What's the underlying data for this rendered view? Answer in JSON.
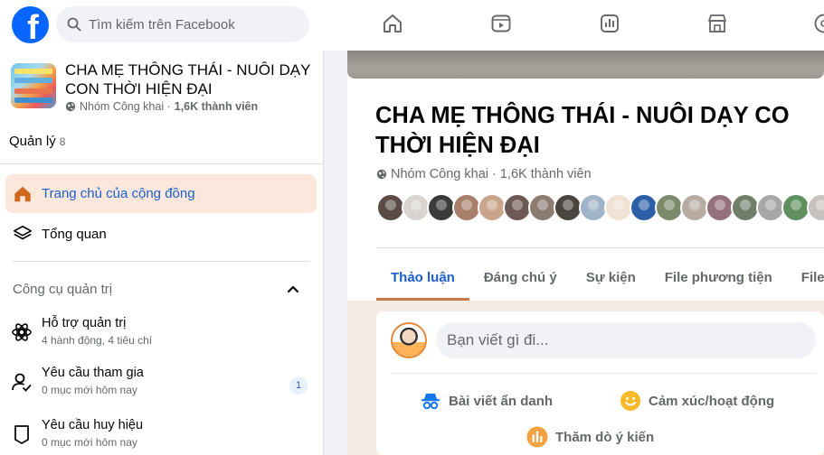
{
  "topbar": {
    "search_placeholder": "Tìm kiếm trên Facebook",
    "nav_icons": [
      "home-icon",
      "video-icon",
      "dashboard-icon",
      "marketplace-icon",
      "gaming-icon"
    ]
  },
  "sidebar": {
    "group_name": "CHA MẸ THÔNG THÁI - NUÔI DẠY CON THỜI HIỆN ĐẠI",
    "group_privacy": "Nhóm Công khai ·",
    "group_members": "1,6K thành viên",
    "manage_label": "Quản lý",
    "manage_count": "8",
    "nav": [
      {
        "label": "Trang chủ của cộng đồng",
        "icon": "home-icon",
        "active": true
      },
      {
        "label": "Tổng quan",
        "icon": "layers-icon",
        "active": false
      }
    ],
    "admin_tools_title": "Công cụ quản trị",
    "tools": [
      {
        "title": "Hỗ trợ quản trị",
        "subtitle": "4 hành động, 4 tiêu chí",
        "icon": "admin-assist-icon"
      },
      {
        "title": "Yêu cầu tham gia",
        "subtitle": "0 mục mới hôm nay",
        "icon": "member-request-icon",
        "badge": "1"
      },
      {
        "title": "Yêu cầu huy hiệu",
        "subtitle": "0 mục mới hôm nay",
        "icon": "badge-request-icon"
      }
    ]
  },
  "main": {
    "title_line1": "CHA MẸ THÔNG THÁI - NUÔI DẠY CO",
    "title_line2": "THỜI HIỆN ĐẠI",
    "privacy": "Nhóm Công khai ·",
    "members": "1,6K thành viên",
    "member_avatar_colors": [
      "#5a4b46",
      "#d8d4d0",
      "#3b3b3b",
      "#a87f6a",
      "#c9a58b",
      "#6d5a54",
      "#8c7b70",
      "#4b4540",
      "#9fb4c8",
      "#efe2d4",
      "#2c5fa8",
      "#7a8a6a",
      "#b8aca2",
      "#94707a",
      "#6f7f6a",
      "#a7a7a7",
      "#5f8f5f",
      "#c7c2bd"
    ],
    "tabs": [
      "Thảo luận",
      "Đáng chú ý",
      "Sự kiện",
      "File phương tiện",
      "File"
    ],
    "composer": {
      "placeholder": "Bạn viết gì đi...",
      "actions": [
        {
          "label": "Bài viết ẩn danh",
          "icon": "anonymous-icon",
          "color": "#1877f2"
        },
        {
          "label": "Cảm xúc/hoạt động",
          "icon": "emoji-icon",
          "color": "#f7b928"
        },
        {
          "label": "Thăm dò ý kiến",
          "icon": "poll-icon",
          "color": "#f5a142"
        }
      ]
    }
  }
}
